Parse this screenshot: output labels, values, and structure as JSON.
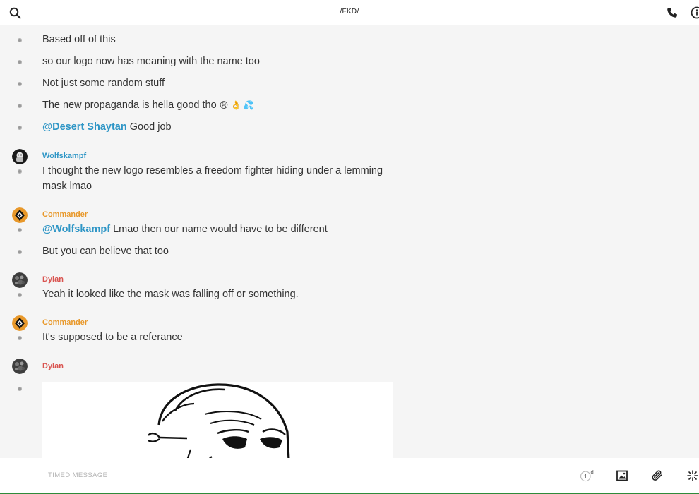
{
  "header": {
    "title": "/FKD/",
    "search_icon": "search-icon",
    "call_icon": "phone-icon",
    "info_icon": "info-icon"
  },
  "messages": [
    {
      "text": "Based off of this"
    },
    {
      "text": "so our logo now has meaning with the name too"
    },
    {
      "text": "Not just some random stuff"
    },
    {
      "text": "The new propaganda is hella good tho",
      "emoji": "😩 👌 💦"
    },
    {
      "mention": "@Desert Shaytan",
      "text": " Good job"
    },
    {
      "author": "Wolfskampf",
      "text": "I thought the new logo resembles a freedom fighter hiding under a lemming mask lmao"
    },
    {
      "author": "Commander",
      "mention": "@Wolfskampf",
      "text": " Lmao then our name would have to be different"
    },
    {
      "text": "But you can believe that too"
    },
    {
      "author": "Dylan",
      "text": "Yeah it looked like the mask was falling off or something."
    },
    {
      "author": "Commander",
      "text": "It's supposed to be a referance"
    },
    {
      "author": "Dylan",
      "attachment": "image"
    }
  ],
  "authors": {
    "wolfskampf": {
      "name": "Wolfskampf",
      "color": "#2f96c6"
    },
    "commander": {
      "name": "Commander",
      "color": "#e8982a"
    },
    "dylan": {
      "name": "Dylan",
      "color": "#d9534f"
    }
  },
  "composer": {
    "placeholder": "TIMED MESSAGE",
    "timer_value": "1",
    "timer_unit": "d",
    "icons": [
      "timer-icon",
      "image-icon",
      "paperclip-icon",
      "sparkle-icon"
    ]
  }
}
